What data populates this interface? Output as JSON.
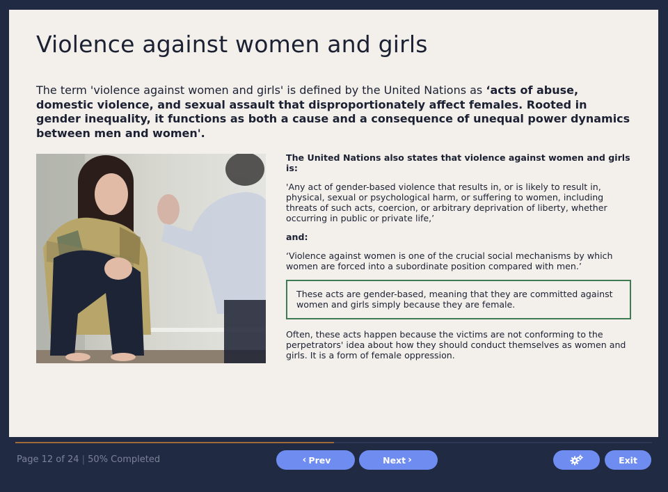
{
  "slide": {
    "title": "Violence against women and girls",
    "intro_plain": "The term 'violence against women and girls' is defined by the United Nations as ",
    "intro_bold": "‘acts of abuse, domestic violence, and sexual assault that disproportionately affect females. Rooted in gender inequality, it functions as both a cause and a consequence of unequal power dynamics between men and women'.",
    "un_heading": "The United Nations also states that violence against women and girls is:",
    "quote1": "'Any act of gender-based violence that results in, or is likely to result in, physical, sexual or psychological harm, or suffering to women, including threats of such acts, coercion, or arbitrary deprivation of liberty, whether occurring in public or private life,’",
    "and_label": "and:",
    "quote2": "‘Violence against women is one of the crucial social mechanisms by which women are forced into a subordinate position compared with men.’",
    "callout": "These acts are gender-based, meaning that they are committed against women and girls simply because they are female.",
    "closing": "Often, these acts happen because the victims are not conforming to the perpetrators' idea about how they should conduct themselves as women and girls. It is a form of female oppression."
  },
  "footer": {
    "page_text": "Page 12 of 24",
    "separator": "|",
    "completed_text": "50% Completed",
    "progress_percent": 50,
    "prev_label": "Prev",
    "next_label": "Next",
    "exit_label": "Exit",
    "prev_icon": "chevron-left-icon",
    "next_icon": "chevron-right-icon",
    "settings_icon": "gears-icon"
  },
  "colors": {
    "background": "#212a43",
    "slide": "#f3efea",
    "button": "#6f8df0",
    "callout_border": "#3e7a52",
    "progress": "#a06a3b"
  }
}
